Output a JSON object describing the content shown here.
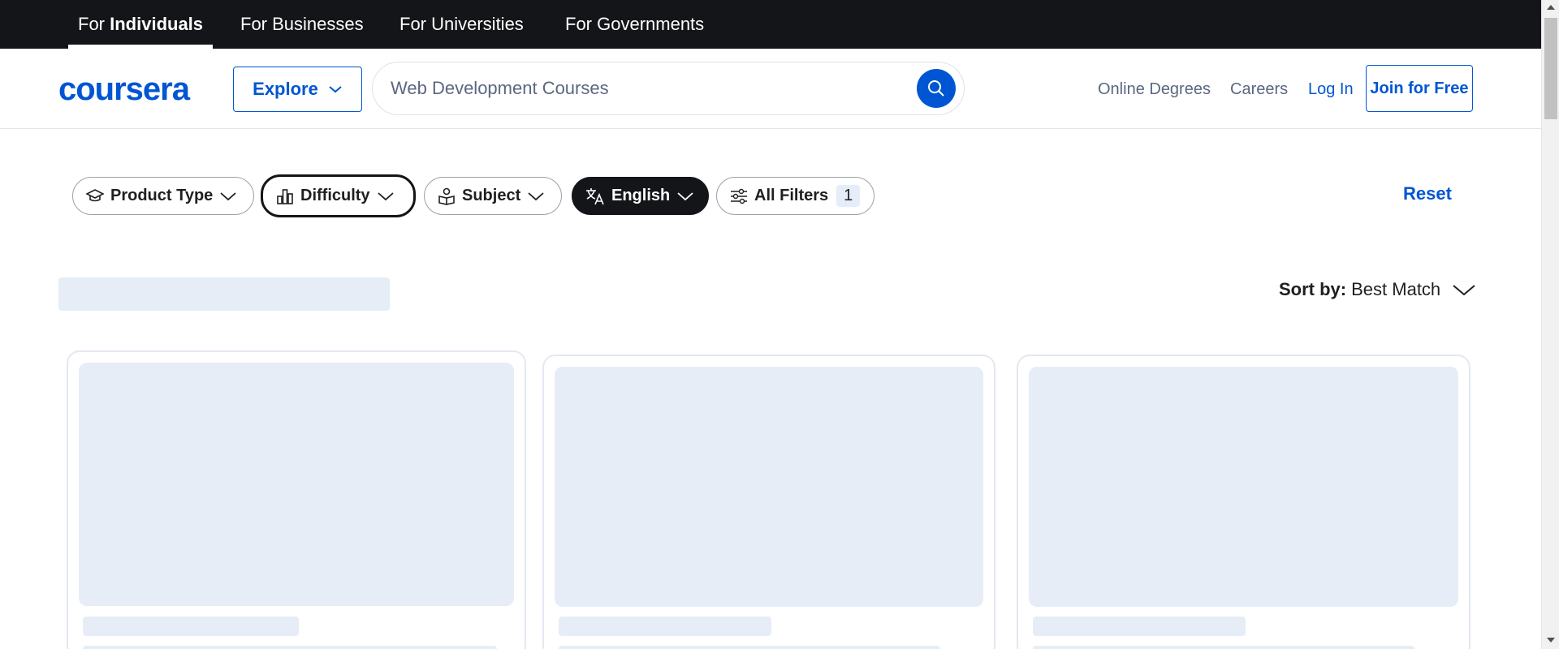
{
  "topbar": {
    "items": [
      {
        "prefix": "For ",
        "label": "Individuals"
      },
      {
        "label": "For Businesses"
      },
      {
        "label": "For Universities"
      },
      {
        "label": "For Governments"
      }
    ]
  },
  "header": {
    "logo": "coursera",
    "explore_label": "Explore",
    "search_value": "Web Development Courses",
    "nav": {
      "online_degrees": "Online Degrees",
      "careers": "Careers",
      "log_in": "Log In",
      "join": "Join for Free"
    }
  },
  "filters": {
    "chips": [
      {
        "label": "Product Type",
        "icon": "graduation-cap-icon"
      },
      {
        "label": "Difficulty",
        "icon": "bar-chart-icon"
      },
      {
        "label": "Subject",
        "icon": "book-user-icon"
      },
      {
        "label": "English",
        "icon": "translate-icon"
      },
      {
        "label": "All Filters",
        "icon": "sliders-icon",
        "count": "1"
      }
    ],
    "reset_label": "Reset"
  },
  "results": {
    "sort_label": "Sort by:",
    "sort_value": "Best Match"
  },
  "colors": {
    "brand": "#0056d2",
    "topbar": "#141518",
    "skeleton": "#e6edf7"
  }
}
